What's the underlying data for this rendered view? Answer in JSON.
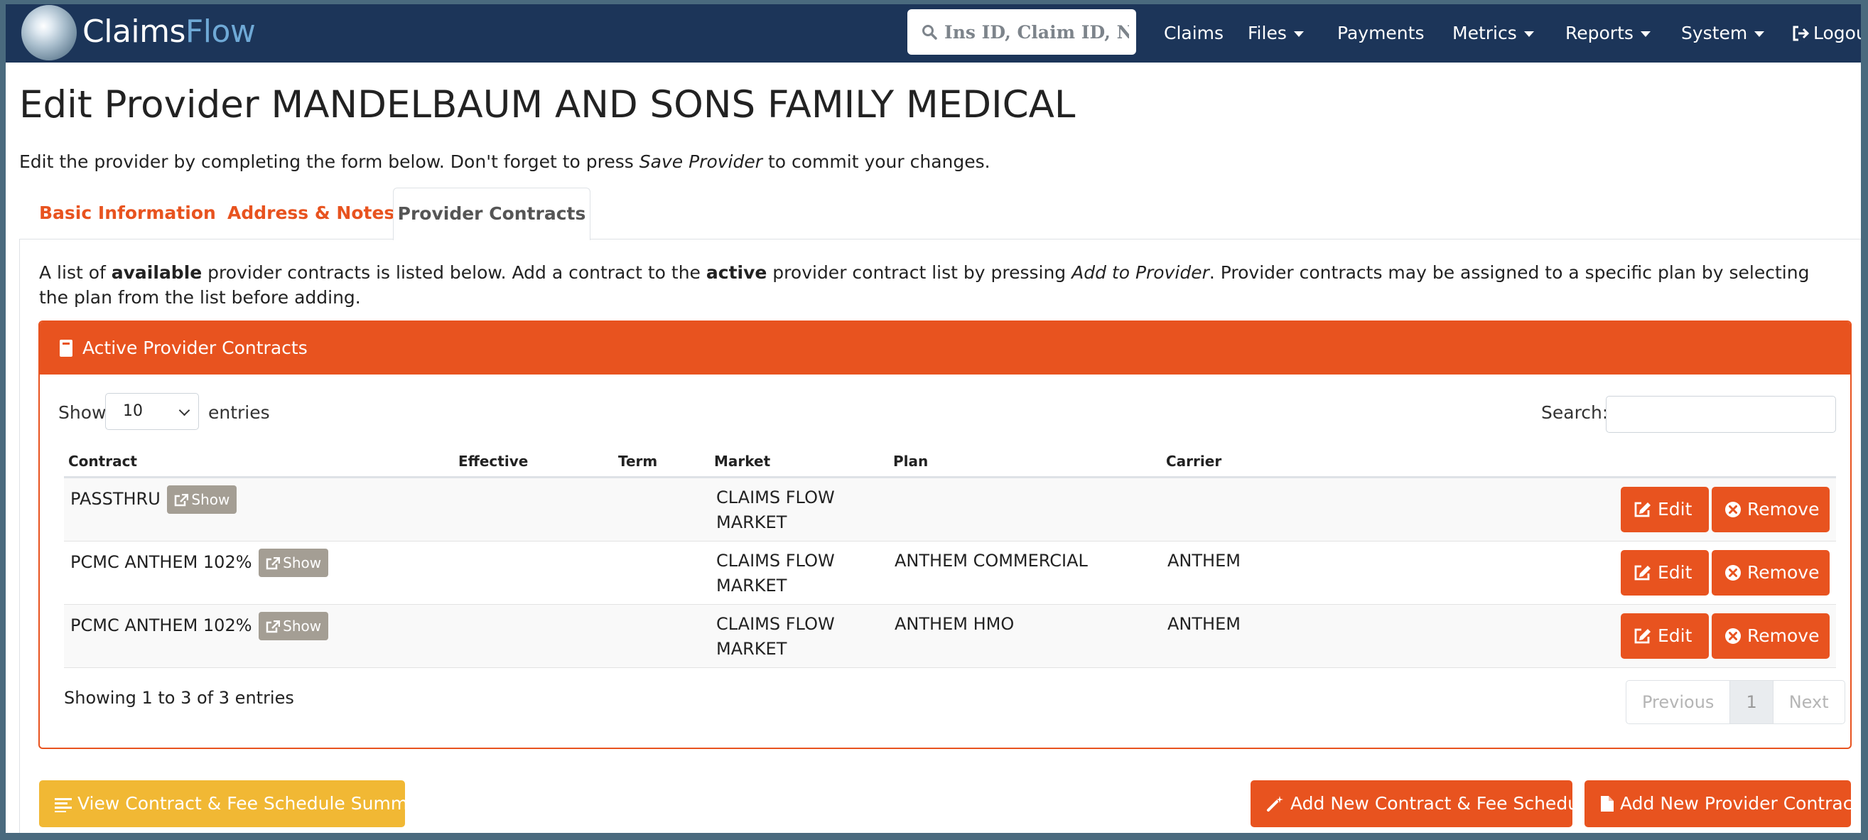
{
  "navbar": {
    "brand_part1": "Claims",
    "brand_part2": "Flow",
    "search_placeholder": "Ins ID, Claim ID, NPI...",
    "items": [
      {
        "label": "Claims",
        "dropdown": false
      },
      {
        "label": "Files",
        "dropdown": true
      },
      {
        "label": "Payments",
        "dropdown": false
      },
      {
        "label": "Metrics",
        "dropdown": true
      },
      {
        "label": "Reports",
        "dropdown": true
      },
      {
        "label": "System",
        "dropdown": true
      },
      {
        "label": "Logout",
        "dropdown": false,
        "icon": "sign-out-icon"
      }
    ]
  },
  "page": {
    "title": "Edit Provider MANDELBAUM AND SONS FAMILY MEDICAL",
    "intro_before": "Edit the provider by completing the form below. Don't forget to press ",
    "intro_em": "Save Provider",
    "intro_after": " to commit your changes."
  },
  "tabs": [
    {
      "label": "Basic Information",
      "active": false
    },
    {
      "label": "Address & Notes",
      "active": false
    },
    {
      "label": "Provider Contracts",
      "active": true
    }
  ],
  "contracts_panel": {
    "desc_1": "A list of ",
    "desc_2": "available",
    "desc_3": " provider contracts is listed below. Add a contract to the ",
    "desc_4": "active",
    "desc_5": " provider contract list by pressing ",
    "desc_6": "Add to Provider",
    "desc_7": ". Provider contracts may be assigned to a specific plan by selecting the plan from the list before adding."
  },
  "card": {
    "header": "Active Provider Contracts",
    "show_label": "Show",
    "page_size": "10",
    "entries_label": "entries",
    "search_label": "Search:",
    "search_value": "",
    "columns": [
      "Contract",
      "Effective",
      "Term",
      "Market",
      "Plan",
      "Carrier"
    ],
    "show_badge": "Show",
    "edit_label": "Edit",
    "remove_label": "Remove",
    "rows": [
      {
        "contract": "PASSTHRU",
        "effective": "",
        "term": "",
        "market_1": "CLAIMS FLOW",
        "market_2": "MARKET",
        "plan": "",
        "carrier": ""
      },
      {
        "contract": "PCMC ANTHEM 102%",
        "effective": "",
        "term": "",
        "market_1": "CLAIMS FLOW",
        "market_2": "MARKET",
        "plan": "ANTHEM COMMERCIAL",
        "carrier": "ANTHEM"
      },
      {
        "contract": "PCMC ANTHEM 102%",
        "effective": "",
        "term": "",
        "market_1": "CLAIMS FLOW",
        "market_2": "MARKET",
        "plan": "ANTHEM HMO",
        "carrier": "ANTHEM"
      }
    ],
    "info": "Showing 1 to 3 of 3 entries",
    "pager_prev": "Previous",
    "pager_current": "1",
    "pager_next": "Next"
  },
  "footer_buttons": {
    "summary": "View Contract & Fee Schedule Summary",
    "add_contract_fee": "Add New Contract & Fee Schedule",
    "add_provider_contract": "Add New Provider Contract"
  },
  "colors": {
    "navbar": "#1c3559",
    "accent": "#e8531f",
    "warning": "#f1b834",
    "badge": "#a49e94"
  }
}
